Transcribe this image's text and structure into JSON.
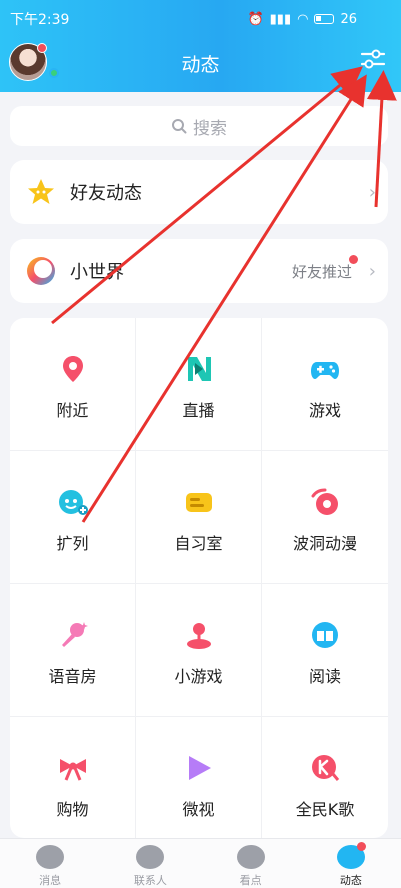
{
  "status_bar": {
    "time": "下午2:39",
    "battery": "26"
  },
  "header": {
    "title": "动态"
  },
  "search": {
    "placeholder": "搜索"
  },
  "friends_feed": {
    "label": "好友动态"
  },
  "small_world": {
    "label": "小世界",
    "hint": "好友推过"
  },
  "grid": [
    {
      "label": "附近",
      "icon": "location-pin-icon",
      "color": "#f5506a"
    },
    {
      "label": "直播",
      "icon": "live-icon",
      "color": "#1ec6b4"
    },
    {
      "label": "游戏",
      "icon": "gamepad-icon",
      "color": "#22b6f2"
    },
    {
      "label": "扩列",
      "icon": "add-friend-icon",
      "color": "#23c0e0"
    },
    {
      "label": "自习室",
      "icon": "study-room-icon",
      "color": "#f8c41a"
    },
    {
      "label": "波洞动漫",
      "icon": "anime-icon",
      "color": "#f5506a"
    },
    {
      "label": "语音房",
      "icon": "microphone-icon",
      "color": "#f57ab6"
    },
    {
      "label": "小游戏",
      "icon": "joystick-icon",
      "color": "#f5506a"
    },
    {
      "label": "阅读",
      "icon": "book-icon",
      "color": "#22b6f2"
    },
    {
      "label": "购物",
      "icon": "bow-icon",
      "color": "#f5506a"
    },
    {
      "label": "微视",
      "icon": "play-icon",
      "color": "#b67cf7"
    },
    {
      "label": "全民K歌",
      "icon": "k-song-icon",
      "color": "#f5506a"
    }
  ],
  "tabs": [
    {
      "label": "消息"
    },
    {
      "label": "联系人"
    },
    {
      "label": "看点"
    },
    {
      "label": "动态"
    }
  ]
}
